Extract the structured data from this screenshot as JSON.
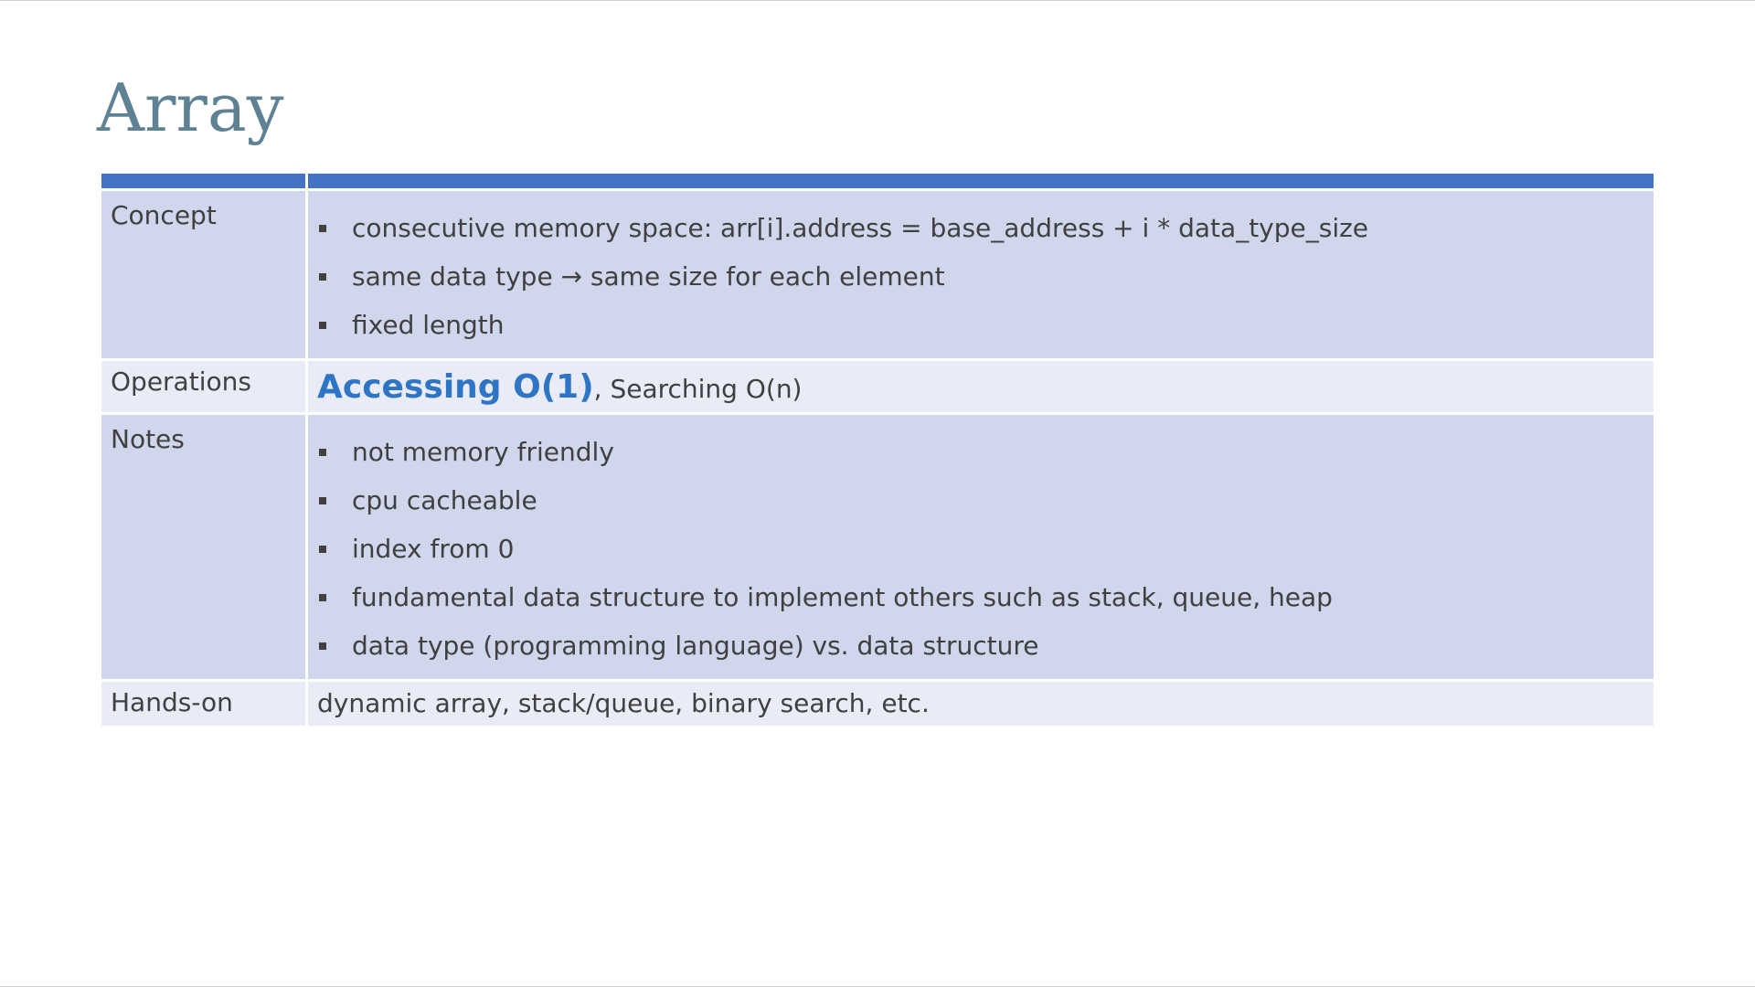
{
  "slide": {
    "title": "Array",
    "colors": {
      "header_bar": "#4472c4",
      "band_dark": "#d0d6eb",
      "band_light": "#e9ecf6",
      "title": "#5e8193",
      "highlight": "#2f75c6"
    }
  },
  "table": {
    "rows": [
      {
        "label": "Concept",
        "bullets": [
          "consecutive memory space: arr[i].address = base_address + i * data_type_size",
          "same data type → same size for each element",
          "fixed length"
        ]
      },
      {
        "label": "Operations",
        "highlight": "Accessing O(1)",
        "rest": ", Searching O(n)"
      },
      {
        "label": "Notes",
        "bullets": [
          "not memory friendly",
          "cpu cacheable",
          "index from 0",
          "fundamental data structure to implement others such as stack, queue, heap",
          "data type (programming language) vs. data structure"
        ]
      },
      {
        "label": "Hands-on",
        "text": "dynamic array, stack/queue, binary search, etc."
      }
    ]
  }
}
